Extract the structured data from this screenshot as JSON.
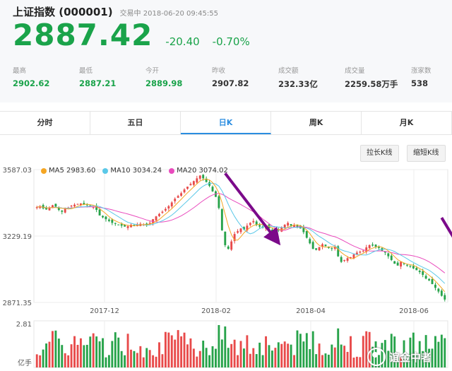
{
  "header": {
    "name": "上证指数 (000001)",
    "status": "交易中 2018-06-20 09:45:55",
    "price": "2887.42",
    "change": "-20.40",
    "change_pct": "-0.70%",
    "stats": [
      {
        "label": "最高",
        "value": "2902.62",
        "color": "#1aa34a"
      },
      {
        "label": "最低",
        "value": "2887.21",
        "color": "#1aa34a"
      },
      {
        "label": "今开",
        "value": "2889.98",
        "color": "#1aa34a"
      },
      {
        "label": "昨收",
        "value": "2907.82",
        "color": "#333333"
      },
      {
        "label": "成交额",
        "value": "232.33亿",
        "color": "#333333"
      },
      {
        "label": "成交量",
        "value": "2259.58万手",
        "color": "#333333"
      },
      {
        "label": "涨家数",
        "value": "538",
        "color": "#333333"
      }
    ]
  },
  "tabs": [
    {
      "label": "分时",
      "active": false
    },
    {
      "label": "五日",
      "active": false
    },
    {
      "label": "日K",
      "active": true
    },
    {
      "label": "周K",
      "active": false
    },
    {
      "label": "月K",
      "active": false
    }
  ],
  "buttons": {
    "widen": "拉长K线",
    "shorten": "缩短K线"
  },
  "legend": [
    {
      "label": "MA5 2983.60",
      "color": "#f5a623"
    },
    {
      "label": "MA10 3034.24",
      "color": "#5ac8e8"
    },
    {
      "label": "MA20 3074.02",
      "color": "#e94bbd"
    }
  ],
  "chart_data": {
    "type": "candlestick",
    "y_ticks": [
      "3587.03",
      "3229.19",
      "2871.35"
    ],
    "ylim": [
      2871.35,
      3587.03
    ],
    "x_ticks": [
      "2017-12",
      "2018-02",
      "2018-04",
      "2018-06"
    ],
    "volume_max_label": "2.81",
    "volume_unit_label": "亿手",
    "colors": {
      "up": "#e84a4a",
      "down": "#27a34a",
      "arrow": "#7b0a8a"
    },
    "closes": [
      3385,
      3390,
      3378,
      3372,
      3380,
      3395,
      3388,
      3370,
      3360,
      3375,
      3382,
      3393,
      3398,
      3402,
      3405,
      3400,
      3395,
      3390,
      3385,
      3370,
      3340,
      3330,
      3320,
      3310,
      3300,
      3295,
      3290,
      3285,
      3280,
      3282,
      3290,
      3286,
      3291,
      3295,
      3292,
      3289,
      3300,
      3320,
      3335,
      3348,
      3360,
      3375,
      3390,
      3410,
      3430,
      3445,
      3460,
      3480,
      3495,
      3510,
      3525,
      3540,
      3555,
      3540,
      3520,
      3500,
      3470,
      3440,
      3380,
      3260,
      3180,
      3160,
      3200,
      3240,
      3255,
      3270,
      3265,
      3285,
      3300,
      3310,
      3290,
      3280,
      3275,
      3285,
      3270,
      3252,
      3255,
      3260,
      3275,
      3290,
      3300,
      3285,
      3290,
      3280,
      3270,
      3250,
      3220,
      3190,
      3160,
      3155,
      3170,
      3185,
      3175,
      3165,
      3160,
      3170,
      3120,
      3090,
      3100,
      3110,
      3115,
      3130,
      3140,
      3145,
      3150,
      3168,
      3180,
      3178,
      3172,
      3165,
      3150,
      3140,
      3120,
      3100,
      3080,
      3070,
      3090,
      3080,
      3070,
      3065,
      3055,
      3045,
      3035,
      3020,
      3000,
      2990,
      2970,
      2950,
      2930,
      2907,
      2887
    ],
    "arrows": [
      {
        "from": [
          3567,
          60
        ],
        "to": [
          3215,
          76
        ]
      },
      {
        "from": [
          3328,
          129
        ],
        "to": [
          3102,
          137
        ]
      },
      {
        "from": [
          3237,
          149
        ],
        "to": [
          3112,
          155
        ]
      },
      {
        "from": [
          3185,
          187
        ],
        "to": [
          3115,
          196
        ]
      },
      {
        "from": [
          3103,
          216
        ],
        "to": [
          2883,
          222
        ]
      }
    ]
  },
  "watermark": {
    "text": "谊金中者"
  }
}
